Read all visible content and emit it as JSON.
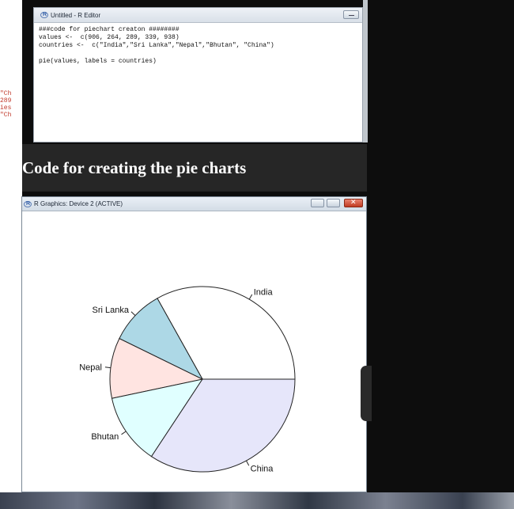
{
  "editor": {
    "title": "Untitled - R Editor",
    "code_lines": [
      "###code for piechart creaton ########",
      "values <-  c(906, 264, 289, 339, 938)",
      "countries <-  c(\"India\",\"Sri Lanka\",\"Nepal\",\"Bhutan\", \"China\")",
      "",
      "pie(values, labels = countries)"
    ]
  },
  "left_fragment": [
    "\"Ch",
    "",
    "289",
    "ies",
    "\"Ch"
  ],
  "caption": "Code for creating the pie charts",
  "graphics": {
    "title": "R Graphics: Device 2 (ACTIVE)"
  },
  "chart_data": {
    "type": "pie",
    "categories": [
      "India",
      "Sri Lanka",
      "Nepal",
      "Bhutan",
      "China"
    ],
    "values": [
      906,
      264,
      289,
      339,
      938
    ],
    "colors": [
      "#ffffff",
      "#add8e6",
      "#ffe4e1",
      "#e0ffff",
      "#e6e6fa"
    ],
    "start_angle": 0,
    "direction": "counterclockwise"
  }
}
